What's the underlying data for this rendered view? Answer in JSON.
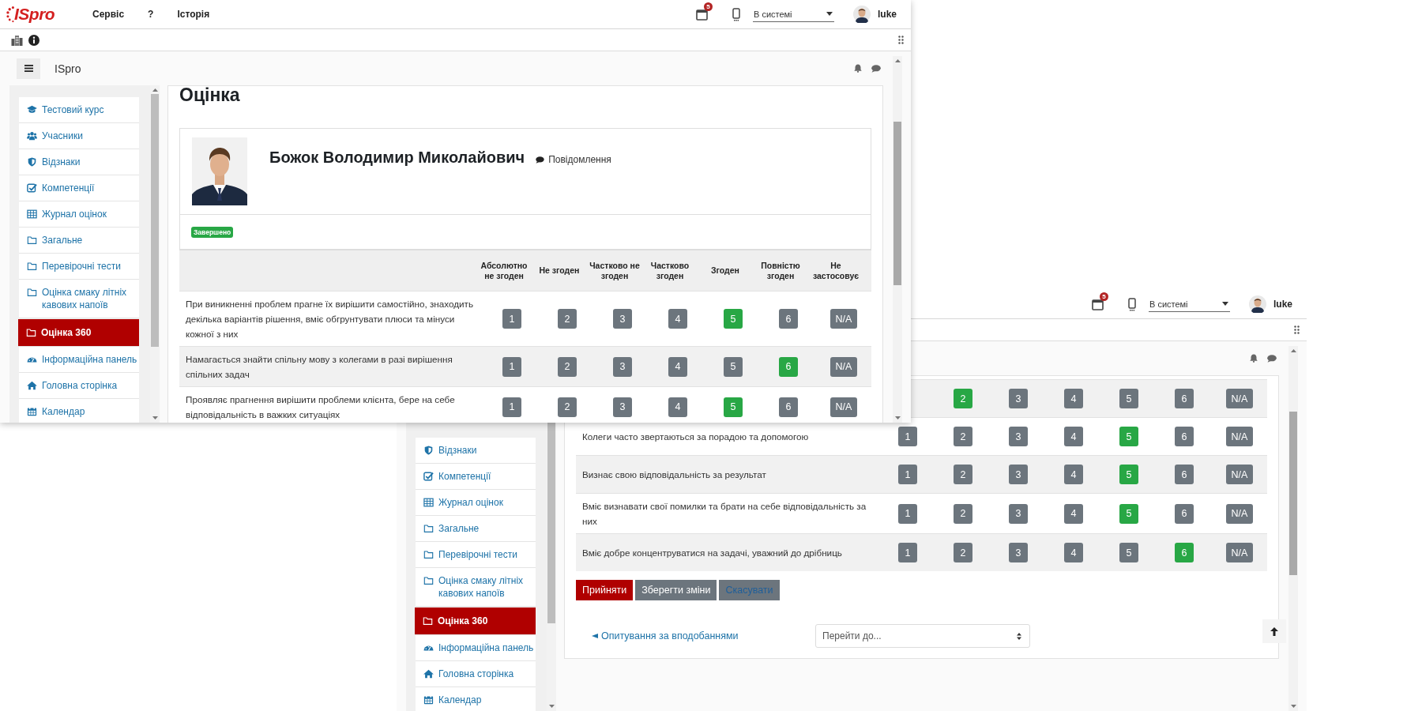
{
  "windows": [
    {
      "kind": "front",
      "logo": "ISpro",
      "menu": [
        "Сервіс",
        "?",
        "Історія"
      ],
      "notification_count": "5",
      "status": "В системі",
      "user": "luke",
      "brand": "ISpro",
      "sidebar": [
        {
          "label": "Тестовий курс",
          "kind": "course",
          "selected": false
        },
        {
          "label": "Учасники",
          "kind": "people",
          "selected": false
        },
        {
          "label": "Відзнаки",
          "kind": "shield",
          "selected": false
        },
        {
          "label": "Компетенції",
          "kind": "check",
          "selected": false
        },
        {
          "label": "Журнал оцінок",
          "kind": "table",
          "selected": false
        },
        {
          "label": "Загальне",
          "kind": "folder",
          "selected": false
        },
        {
          "label": "Перевірочні тести",
          "kind": "folder",
          "selected": false
        },
        {
          "label": "Оцінка смаку літніх кавових напоїв",
          "kind": "folder",
          "selected": false
        },
        {
          "label": "Оцінка 360",
          "kind": "folder",
          "selected": true
        },
        {
          "label": "Інформаційна панель",
          "kind": "gauge",
          "selected": false
        },
        {
          "label": "Головна сторінка",
          "kind": "home",
          "selected": false
        },
        {
          "label": "Календар",
          "kind": "calendar",
          "selected": false
        }
      ],
      "page_title": "Оцінка",
      "profile": {
        "name": "Божок Володимир Миколайович",
        "message": "Повідомлення"
      },
      "status_badge": "Завершено",
      "columns": [
        "Абсолютно не згоден",
        "Не згоден",
        "Частково не згоден",
        "Частково згоден",
        "Згоден",
        "Повністю згоден",
        "Не застосовує"
      ],
      "rows": [
        {
          "statement": "При виникненні проблем прагне їх вирішити самостійно, знаходить декілька варіантів рішення, вміє обгрунтувати плюси та мінуси кожної з них",
          "shaded": false,
          "options": [
            {
              "label": "1",
              "selected": false
            },
            {
              "label": "2",
              "selected": false
            },
            {
              "label": "3",
              "selected": false
            },
            {
              "label": "4",
              "selected": false
            },
            {
              "label": "5",
              "selected": true
            },
            {
              "label": "6",
              "selected": false
            },
            {
              "label": "N/A",
              "selected": false
            }
          ]
        },
        {
          "statement": "Намагається знайти спільну мову з колегами в разі вирішення спільних задач",
          "shaded": true,
          "options": [
            {
              "label": "1",
              "selected": false
            },
            {
              "label": "2",
              "selected": false
            },
            {
              "label": "3",
              "selected": false
            },
            {
              "label": "4",
              "selected": false
            },
            {
              "label": "5",
              "selected": false
            },
            {
              "label": "6",
              "selected": true
            },
            {
              "label": "N/A",
              "selected": false
            }
          ]
        },
        {
          "statement": "Проявляє прагнення вирішити проблеми клієнта, бере на себе відповідальність в важких ситуаціях",
          "shaded": false,
          "options": [
            {
              "label": "1",
              "selected": false
            },
            {
              "label": "2",
              "selected": false
            },
            {
              "label": "3",
              "selected": false
            },
            {
              "label": "4",
              "selected": false
            },
            {
              "label": "5",
              "selected": true
            },
            {
              "label": "6",
              "selected": false
            },
            {
              "label": "N/A",
              "selected": false
            }
          ]
        }
      ]
    },
    {
      "kind": "back",
      "notification_count": "5",
      "status": "В системі",
      "user": "luke",
      "sidebar": [
        {
          "label": "Відзнаки",
          "kind": "shield",
          "selected": false
        },
        {
          "label": "Компетенції",
          "kind": "check",
          "selected": false
        },
        {
          "label": "Журнал оцінок",
          "kind": "table",
          "selected": false
        },
        {
          "label": "Загальне",
          "kind": "folder",
          "selected": false
        },
        {
          "label": "Перевірочні тести",
          "kind": "folder",
          "selected": false
        },
        {
          "label": "Оцінка смаку літніх кавових напоїв",
          "kind": "folder",
          "selected": false
        },
        {
          "label": "Оцінка 360",
          "kind": "folder",
          "selected": true
        },
        {
          "label": "Інформаційна панель",
          "kind": "gauge",
          "selected": false
        },
        {
          "label": "Головна сторінка",
          "kind": "home",
          "selected": false
        },
        {
          "label": "Календар",
          "kind": "calendar",
          "selected": false
        }
      ],
      "rows": [
        {
          "shaded": true,
          "options": [
            {
              "label": "2",
              "selected": true
            },
            {
              "label": "3",
              "selected": false
            },
            {
              "label": "4",
              "selected": false
            },
            {
              "label": "5",
              "selected": false
            },
            {
              "label": "6",
              "selected": false
            },
            {
              "label": "N/A",
              "selected": false
            }
          ]
        },
        {
          "statement": "Колеги часто звертаються за порадою та допомогою",
          "shaded": false,
          "options": [
            {
              "label": "1",
              "selected": false
            },
            {
              "label": "2",
              "selected": false
            },
            {
              "label": "3",
              "selected": false
            },
            {
              "label": "4",
              "selected": false
            },
            {
              "label": "5",
              "selected": true
            },
            {
              "label": "6",
              "selected": false
            },
            {
              "label": "N/A",
              "selected": false
            }
          ]
        },
        {
          "statement": "Визнає свою відповідальність за результат",
          "shaded": true,
          "options": [
            {
              "label": "1",
              "selected": false
            },
            {
              "label": "2",
              "selected": false
            },
            {
              "label": "3",
              "selected": false
            },
            {
              "label": "4",
              "selected": false
            },
            {
              "label": "5",
              "selected": true
            },
            {
              "label": "6",
              "selected": false
            },
            {
              "label": "N/A",
              "selected": false
            }
          ]
        },
        {
          "statement": "Вміє визнавати свої помилки та брати на себе відповідальність за них",
          "shaded": false,
          "options": [
            {
              "label": "1",
              "selected": false
            },
            {
              "label": "2",
              "selected": false
            },
            {
              "label": "3",
              "selected": false
            },
            {
              "label": "4",
              "selected": false
            },
            {
              "label": "5",
              "selected": true
            },
            {
              "label": "6",
              "selected": false
            },
            {
              "label": "N/A",
              "selected": false
            }
          ]
        },
        {
          "statement": "Вміє добре концентруватися на задачі, уважний до дрібниць",
          "shaded": true,
          "options": [
            {
              "label": "1",
              "selected": false
            },
            {
              "label": "2",
              "selected": false
            },
            {
              "label": "3",
              "selected": false
            },
            {
              "label": "4",
              "selected": false
            },
            {
              "label": "5",
              "selected": false
            },
            {
              "label": "6",
              "selected": true
            },
            {
              "label": "N/A",
              "selected": false
            }
          ]
        }
      ],
      "actions": [
        {
          "label": "Прийняти",
          "kind": "primary"
        },
        {
          "label": "Зберегти зміни",
          "kind": "secondary"
        },
        {
          "label": "Скасувати",
          "kind": "cancel"
        }
      ],
      "previous_link": "Опитування за вподобаннями",
      "jump_select": {
        "placeholder": "Перейти до..."
      }
    }
  ]
}
